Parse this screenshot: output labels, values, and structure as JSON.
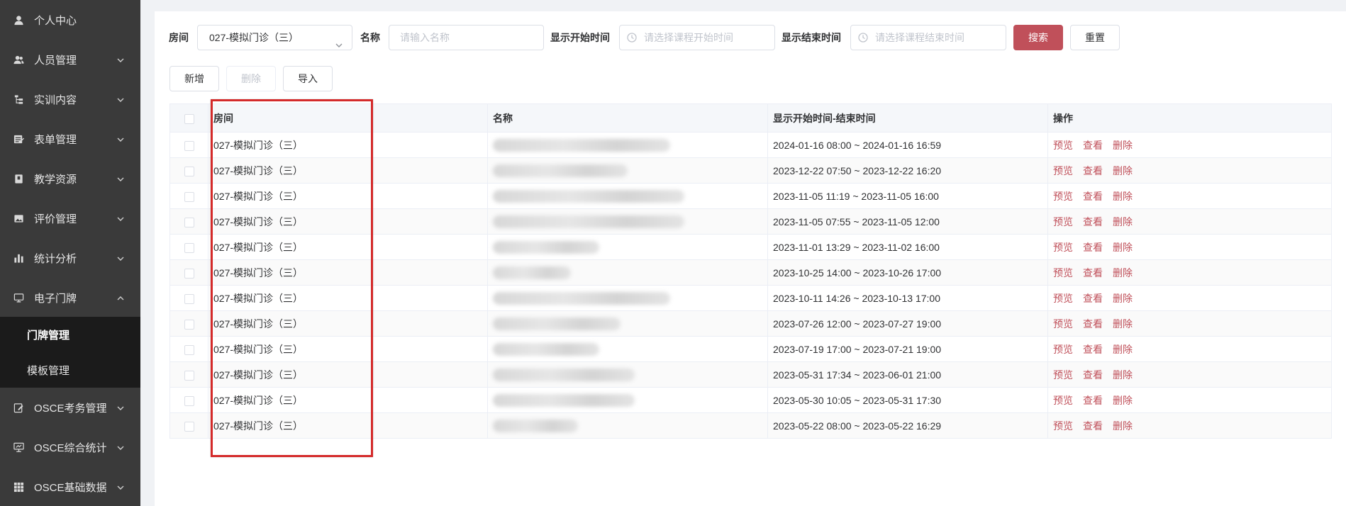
{
  "sidebar": {
    "items": [
      {
        "label": "个人中心",
        "icon": "user-icon",
        "has_chevron": false
      },
      {
        "label": "人员管理",
        "icon": "users-icon",
        "has_chevron": true
      },
      {
        "label": "实训内容",
        "icon": "tree-icon",
        "has_chevron": true
      },
      {
        "label": "表单管理",
        "icon": "form-icon",
        "has_chevron": true
      },
      {
        "label": "教学资源",
        "icon": "book-icon",
        "has_chevron": true
      },
      {
        "label": "评价管理",
        "icon": "image-icon",
        "has_chevron": true
      },
      {
        "label": "统计分析",
        "icon": "bar-chart-icon",
        "has_chevron": true
      },
      {
        "label": "电子门牌",
        "icon": "monitor-icon",
        "has_chevron": true,
        "expanded": true
      },
      {
        "label": "OSCE考务管理",
        "icon": "edit-icon",
        "has_chevron": true
      },
      {
        "label": "OSCE综合统计",
        "icon": "presentation-icon",
        "has_chevron": true
      },
      {
        "label": "OSCE基础数据",
        "icon": "grid-icon",
        "has_chevron": true
      }
    ],
    "submenu": [
      {
        "label": "门牌管理",
        "active": true
      },
      {
        "label": "模板管理",
        "active": false
      }
    ]
  },
  "search": {
    "room_label": "房间",
    "room_value": "027-模拟门诊（三）",
    "name_label": "名称",
    "name_placeholder": "请输入名称",
    "start_label": "显示开始时间",
    "start_placeholder": "请选择课程开始时间",
    "end_label": "显示结束时间",
    "end_placeholder": "请选择课程结束时间",
    "search_button": "搜索",
    "reset_button": "重置"
  },
  "toolbar": {
    "add_label": "新增",
    "delete_label": "删除",
    "import_label": "导入"
  },
  "table": {
    "headers": [
      "房间",
      "名称",
      "显示开始时间-结束时间",
      "操作"
    ],
    "actions": [
      "预览",
      "查看",
      "删除"
    ],
    "rows": [
      {
        "room": "027-模拟门诊（三）",
        "time": "2024-01-16 08:00 ~ 2024-01-16 16:59"
      },
      {
        "room": "027-模拟门诊（三）",
        "time": "2023-12-22 07:50 ~ 2023-12-22 16:20"
      },
      {
        "room": "027-模拟门诊（三）",
        "time": "2023-11-05 11:19 ~ 2023-11-05 16:00"
      },
      {
        "room": "027-模拟门诊（三）",
        "time": "2023-11-05 07:55 ~ 2023-11-05 12:00"
      },
      {
        "room": "027-模拟门诊（三）",
        "time": "2023-11-01 13:29 ~ 2023-11-02 16:00"
      },
      {
        "room": "027-模拟门诊（三）",
        "time": "2023-10-25 14:00 ~ 2023-10-26 17:00"
      },
      {
        "room": "027-模拟门诊（三）",
        "time": "2023-10-11 14:26 ~ 2023-10-13 17:00"
      },
      {
        "room": "027-模拟门诊（三）",
        "time": "2023-07-26 12:00 ~ 2023-07-27 19:00"
      },
      {
        "room": "027-模拟门诊（三）",
        "time": "2023-07-19 17:00 ~ 2023-07-21 19:00"
      },
      {
        "room": "027-模拟门诊（三）",
        "time": "2023-05-31 17:34 ~ 2023-06-01 21:00"
      },
      {
        "room": "027-模拟门诊（三）",
        "time": "2023-05-30 10:05 ~ 2023-05-31 17:30"
      },
      {
        "room": "027-模拟门诊（三）",
        "time": "2023-05-22 08:00 ~ 2023-05-22 16:29"
      }
    ]
  },
  "colors": {
    "sidebar_bg": "#3a3a3a",
    "submenu_bg": "#1b1b1b",
    "primary": "#c0505a",
    "highlight": "#d42a2a"
  }
}
